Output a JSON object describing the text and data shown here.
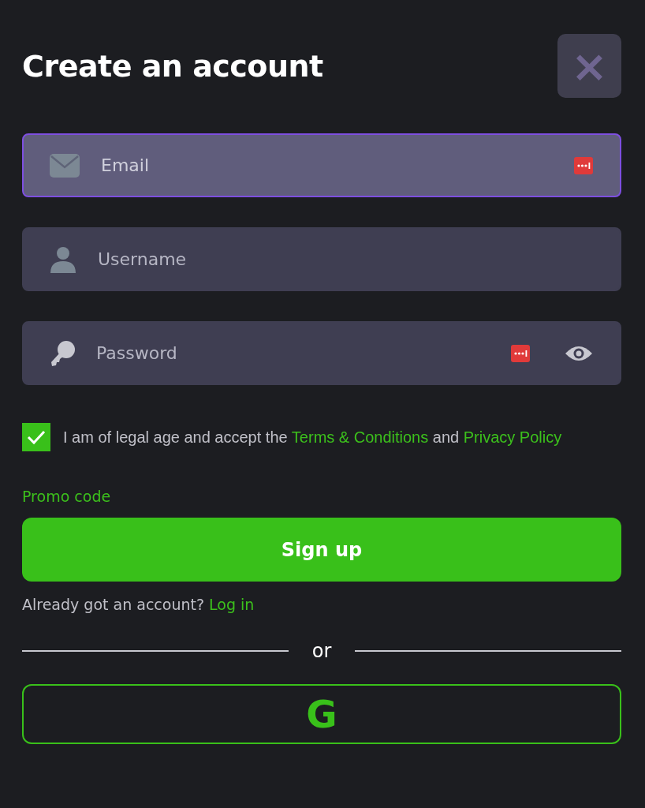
{
  "title": "Create an account",
  "close_button": {
    "label": "×"
  },
  "fields": [
    {
      "kind": "email",
      "placeholder": "Email",
      "focused": true,
      "password_manager": true,
      "reveal": false
    },
    {
      "kind": "username",
      "placeholder": "Username",
      "focused": false,
      "password_manager": false,
      "reveal": false
    },
    {
      "kind": "password",
      "placeholder": "Password",
      "focused": false,
      "password_manager": true,
      "reveal": true
    }
  ],
  "consent": {
    "checked": true,
    "text": "I am of legal age and accept the",
    "terms_link": "Terms & Conditions",
    "joiner": "and",
    "privacy_link": "Privacy Policy"
  },
  "promo_link": "Promo code",
  "signup_button": "Sign up",
  "login_prompt": {
    "text": "Already got an account?",
    "link": "Log in"
  },
  "divider": "or",
  "social_button": {
    "label": "G"
  }
}
